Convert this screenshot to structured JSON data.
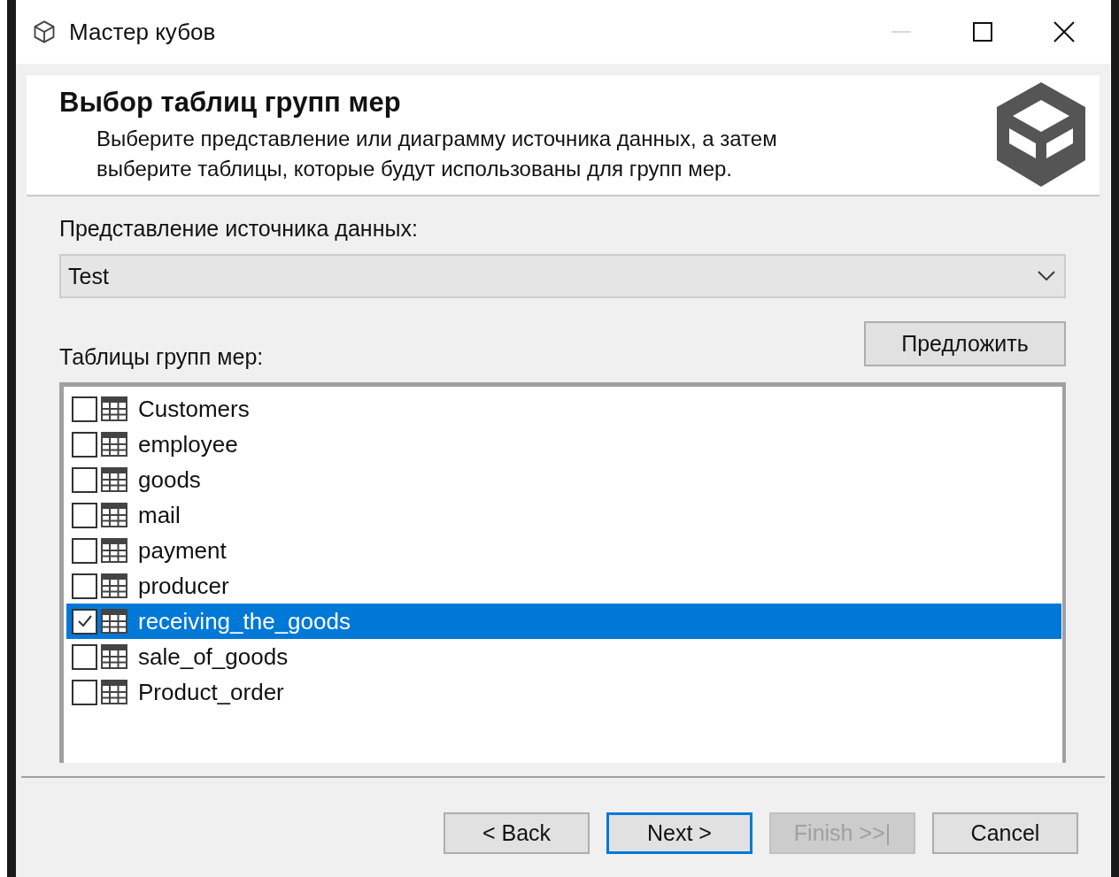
{
  "window": {
    "title": "Мастер кубов"
  },
  "header": {
    "title": "Выбор таблиц групп мер",
    "description": "Выберите представление или диаграмму источника данных, а затем выберите таблицы, которые будут использованы для групп мер."
  },
  "data_source_view": {
    "label": "Представление источника данных:",
    "value": "Test"
  },
  "tables_label": "Таблицы групп мер:",
  "suggest_button": "Предложить",
  "tables": [
    {
      "name": "Customers",
      "checked": false,
      "selected": false
    },
    {
      "name": "employee",
      "checked": false,
      "selected": false
    },
    {
      "name": "goods",
      "checked": false,
      "selected": false
    },
    {
      "name": "mail",
      "checked": false,
      "selected": false
    },
    {
      "name": "payment",
      "checked": false,
      "selected": false
    },
    {
      "name": "producer",
      "checked": false,
      "selected": false
    },
    {
      "name": "receiving_the_goods",
      "checked": true,
      "selected": true
    },
    {
      "name": "sale_of_goods",
      "checked": false,
      "selected": false
    },
    {
      "name": "Product_order",
      "checked": false,
      "selected": false
    }
  ],
  "buttons": [
    {
      "label": "< Back",
      "disabled": false,
      "default": false
    },
    {
      "label": "Next >",
      "disabled": false,
      "default": true
    },
    {
      "label": "Finish >>|",
      "disabled": true,
      "default": false
    },
    {
      "label": "Cancel",
      "disabled": false,
      "default": false
    }
  ]
}
